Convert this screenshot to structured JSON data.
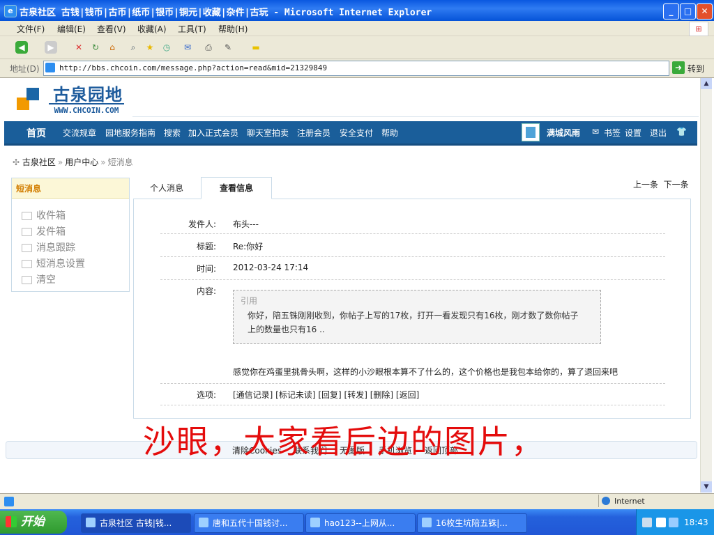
{
  "window": {
    "title": "古泉社区 古钱|钱币|古币|纸币|银币|铜元|收藏|杂件|古玩 - Microsoft Internet Explorer",
    "min": "_",
    "max": "□",
    "close": "✕"
  },
  "menu": [
    "文件(F)",
    "编辑(E)",
    "查看(V)",
    "收藏(A)",
    "工具(T)",
    "帮助(H)"
  ],
  "address": {
    "label": "地址(D)",
    "url": "http://bbs.chcoin.com/message.php?action=read&mid=21329849",
    "go": "转到"
  },
  "site": {
    "name": "古泉园地",
    "url": "WWW.CHCOIN.COM"
  },
  "nav": {
    "home": "首页",
    "items": [
      "交流规章",
      "园地服务指南",
      "搜索",
      "加入正式会员",
      "聊天室拍卖",
      "注册会员",
      "安全支付",
      "帮助"
    ],
    "username": "满城风雨",
    "bookmark": "书签",
    "settings": "设置",
    "logout": "退出"
  },
  "breadcrumb": [
    "古泉社区",
    "用户中心",
    "短消息"
  ],
  "sidebar": {
    "title": "短消息",
    "items": [
      "收件箱",
      "发件箱",
      "消息跟踪",
      "短消息设置",
      "清空"
    ]
  },
  "tabs": [
    "个人消息",
    "查看信息"
  ],
  "pager": {
    "prev": "上一条",
    "next": "下一条"
  },
  "message": {
    "sender_label": "发件人:",
    "sender": "布头---",
    "subject_label": "标题:",
    "subject": "Re:你好",
    "time_label": "时间:",
    "time": "2012-03-24 17:14",
    "content_label": "内容:",
    "quote_label": "引用",
    "quote_text": "你好，陪五铢刚刚收到，你帖子上写的17枚，打开一看发现只有16枚，刚才数了数你帖子上的数量也只有16 ..",
    "reply": "感觉你在鸡蛋里挑骨头啊，这样的小沙眼根本算不了什么的，这个价格也是我包本给你的，算了退回来吧",
    "options_label": "选项:",
    "options": "[通信记录] [标记未读] [回复] [转发] [删除] [返回]"
  },
  "footer": [
    "清除Cookies",
    "联系我们",
    "无图版",
    "手机浏览",
    "返回顶部"
  ],
  "overlay_text": "沙眼，大家看后边的图片，",
  "status": {
    "zone": "Internet"
  },
  "taskbar": {
    "start": "开始",
    "tasks": [
      "古泉社区 古钱|钱...",
      "唐和五代十国钱讨...",
      "hao123--上网从...",
      "16枚生坑陪五铢|..."
    ],
    "clock": "18:43"
  }
}
